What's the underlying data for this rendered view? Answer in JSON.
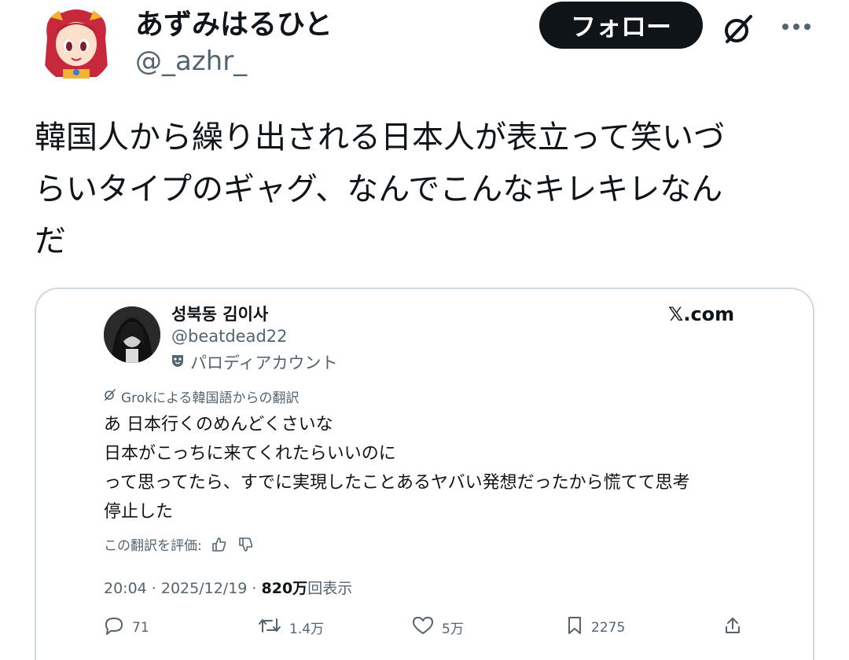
{
  "author": {
    "name": "あずみはるひと",
    "handle": "@_azhr_"
  },
  "header": {
    "follow_label": "フォロー",
    "grok_icon": "grok-icon",
    "more_icon": "more-icon"
  },
  "tweet": {
    "lines": [
      "韓国人から繰り出される日本人が表立って笑いづ",
      "らいタイプのギャグ、なんでこんなキレキレなん",
      "だ"
    ]
  },
  "quoted": {
    "name": "성북동 김이사",
    "handle": "@beatdead22",
    "parody_label": "パロディアカウント",
    "source": "𝕏.com",
    "translation_note": "Grokによる韓国語からの翻訳",
    "lines": [
      "あ 日本行くのめんどくさいな",
      "日本がこっちに来てくれたらいいのに",
      "って思ってたら、すでに実現したことあるヤバい発想だったから慌てて思考",
      "停止した"
    ],
    "rate_label": "この翻訳を評価:",
    "time": "20:04 · 2025/12/19 · ",
    "views_value": "820万",
    "views_label": "回表示",
    "actions": {
      "replies": "71",
      "reposts": "1.4万",
      "likes": "5万",
      "bookmarks": "2275"
    }
  }
}
